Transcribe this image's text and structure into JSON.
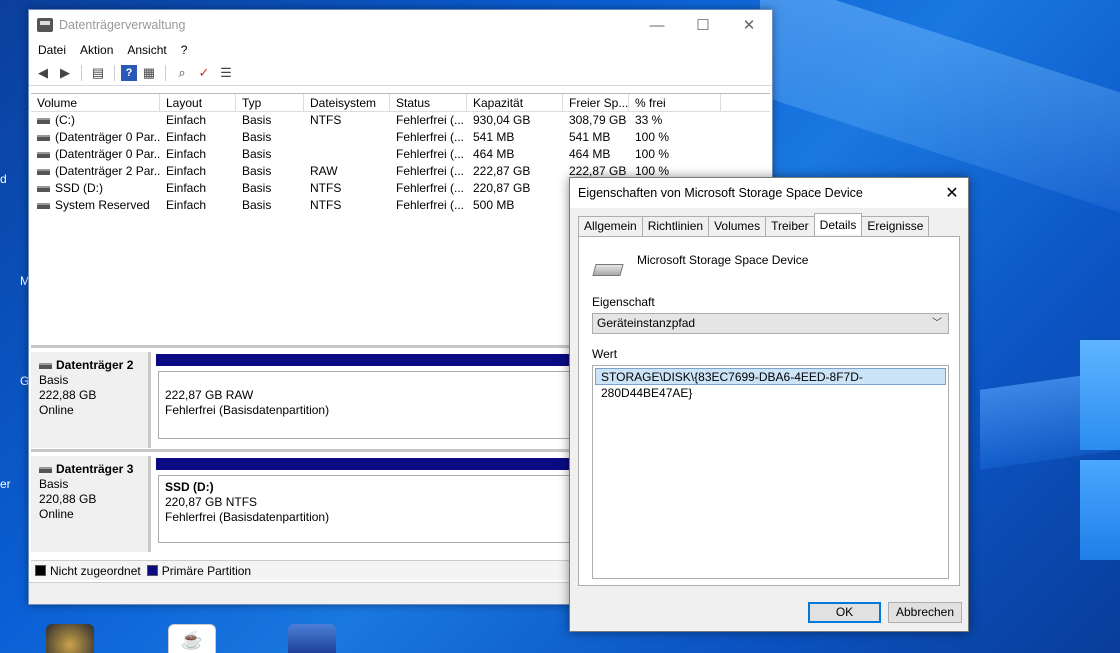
{
  "desktop": {
    "edge_letters": [
      "d",
      "M",
      "G",
      "er"
    ]
  },
  "window": {
    "title": "Datenträgerverwaltung",
    "minimize": "—",
    "maximize": "☐",
    "close": "✕"
  },
  "menu": [
    "Datei",
    "Aktion",
    "Ansicht",
    "?"
  ],
  "toolbar_icons": [
    "back-icon",
    "forward-icon",
    "console-tree-icon",
    "help-icon",
    "properties-icon",
    "connect-icon",
    "check-icon",
    "list-icon"
  ],
  "volume_table": {
    "headers": [
      "Volume",
      "Layout",
      "Typ",
      "Dateisystem",
      "Status",
      "Kapazität",
      "Freier Sp...",
      "% frei"
    ],
    "rows": [
      [
        "(C:)",
        "Einfach",
        "Basis",
        "NTFS",
        "Fehlerfrei (...",
        "930,04 GB",
        "308,79 GB",
        "33 %"
      ],
      [
        "(Datenträger 0 Par...",
        "Einfach",
        "Basis",
        "",
        "Fehlerfrei (...",
        "541 MB",
        "541 MB",
        "100 %"
      ],
      [
        "(Datenträger 0 Par...",
        "Einfach",
        "Basis",
        "",
        "Fehlerfrei (...",
        "464 MB",
        "464 MB",
        "100 %"
      ],
      [
        "(Datenträger 2 Par...",
        "Einfach",
        "Basis",
        "RAW",
        "Fehlerfrei (...",
        "222,87 GB",
        "222,87 GB",
        "100 %"
      ],
      [
        "SSD (D:)",
        "Einfach",
        "Basis",
        "NTFS",
        "Fehlerfrei (...",
        "220,87 GB",
        "",
        ""
      ],
      [
        "System Reserved",
        "Einfach",
        "Basis",
        "NTFS",
        "Fehlerfrei (...",
        "500 MB",
        "",
        ""
      ]
    ]
  },
  "disks": [
    {
      "name": "Datenträger 2",
      "type": "Basis",
      "size": "222,88 GB",
      "state": "Online",
      "partition_title": "",
      "partition_line1": "222,87 GB RAW",
      "partition_line2": "Fehlerfrei (Basisdatenpartition)"
    },
    {
      "name": "Datenträger 3",
      "type": "Basis",
      "size": "220,88 GB",
      "state": "Online",
      "partition_title": "SSD  (D:)",
      "partition_line1": "220,87 GB NTFS",
      "partition_line2": "Fehlerfrei (Basisdatenpartition)"
    }
  ],
  "legend": {
    "unallocated": "Nicht zugeordnet",
    "primary": "Primäre Partition",
    "unallocated_color": "#000000",
    "primary_color": "#0a0a82"
  },
  "dialog": {
    "title": "Eigenschaften von Microsoft Storage Space Device",
    "close": "✕",
    "tabs": [
      "Allgemein",
      "Richtlinien",
      "Volumes",
      "Treiber",
      "Details",
      "Ereignisse"
    ],
    "active_tab": "Details",
    "device_name": "Microsoft Storage Space Device",
    "property_label": "Eigenschaft",
    "property_value": "Geräteinstanzpfad",
    "value_label": "Wert",
    "value": "STORAGE\\DISK\\{83EC7699-DBA6-4EED-8F7D-280D44BE47AE}",
    "ok": "OK",
    "cancel": "Abbrechen"
  }
}
